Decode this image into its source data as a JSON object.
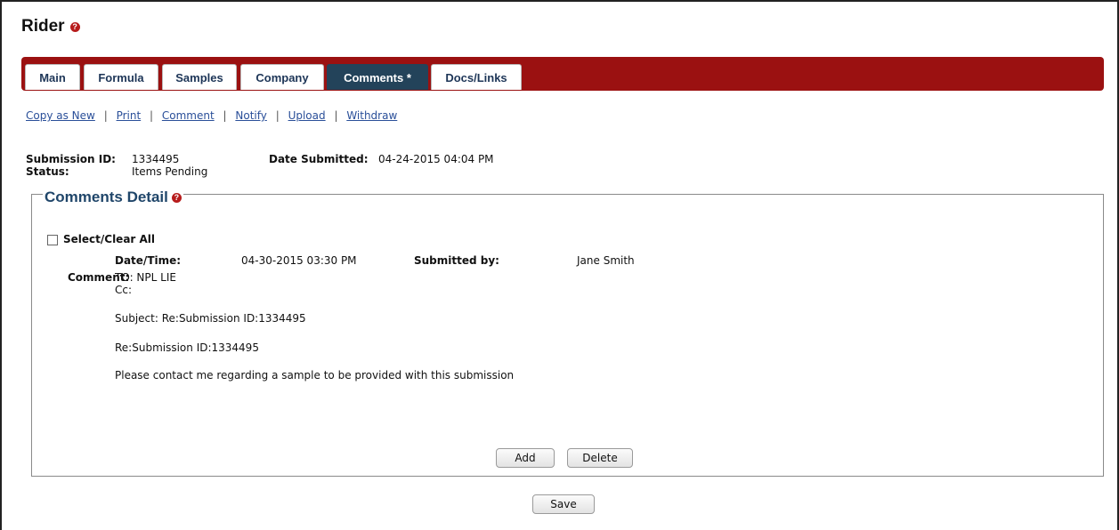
{
  "page": {
    "title": "Rider",
    "help_icon": "?"
  },
  "tabs": [
    {
      "label": "Main",
      "active": false
    },
    {
      "label": "Formula",
      "active": false
    },
    {
      "label": "Samples",
      "active": false
    },
    {
      "label": "Company",
      "active": false
    },
    {
      "label": "Comments *",
      "active": true
    },
    {
      "label": "Docs/Links",
      "active": false
    }
  ],
  "actions": [
    "Copy as New",
    "Print",
    "Comment",
    "Notify",
    "Upload",
    "Withdraw"
  ],
  "submission": {
    "id_label": "Submission ID:",
    "id_value": "1334495",
    "status_label": "Status:",
    "status_value": "Items Pending",
    "date_label": "Date Submitted:",
    "date_value": "04-24-2015 04:04 PM"
  },
  "comments_detail": {
    "legend": "Comments Detail",
    "select_all_label": "Select/Clear All",
    "datetime_label": "Date/Time:",
    "datetime_value": "04-30-2015 03:30 PM",
    "submitted_by_label": "Submitted by:",
    "submitted_by_value": "Jane Smith",
    "comment_label": "Comment:",
    "comment_lines": [
      "TO: NPL LIE",
      "Cc:",
      "Subject: Re:Submission ID:1334495",
      "Re:Submission ID:1334495",
      "Please contact me regarding a sample to be provided with this submission"
    ],
    "add_label": "Add",
    "delete_label": "Delete"
  },
  "footer": {
    "save_label": "Save"
  },
  "colors": {
    "tab_bar": "#9b1111",
    "active_tab": "#23435a",
    "link": "#2a4f99",
    "legend_text": "#20466a",
    "help_icon": "#b71c1c"
  }
}
